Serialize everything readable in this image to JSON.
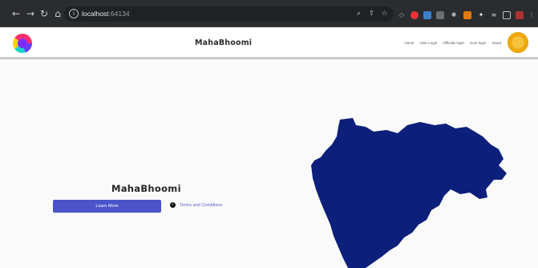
{
  "browser": {
    "url_host": "localhost",
    "url_port": ":64134"
  },
  "header": {
    "brand": "MahaBhoomi",
    "nav": [
      "Home",
      "User Login",
      "Officials login",
      "Govt login",
      "About"
    ]
  },
  "hero": {
    "title": "MahaBhoomi",
    "learn_more": "Learn More",
    "terms": "Terms and Conditions"
  },
  "colors": {
    "map_fill": "#0c1f7a",
    "button_bg": "#4b53c9",
    "link": "#5a63c8"
  }
}
